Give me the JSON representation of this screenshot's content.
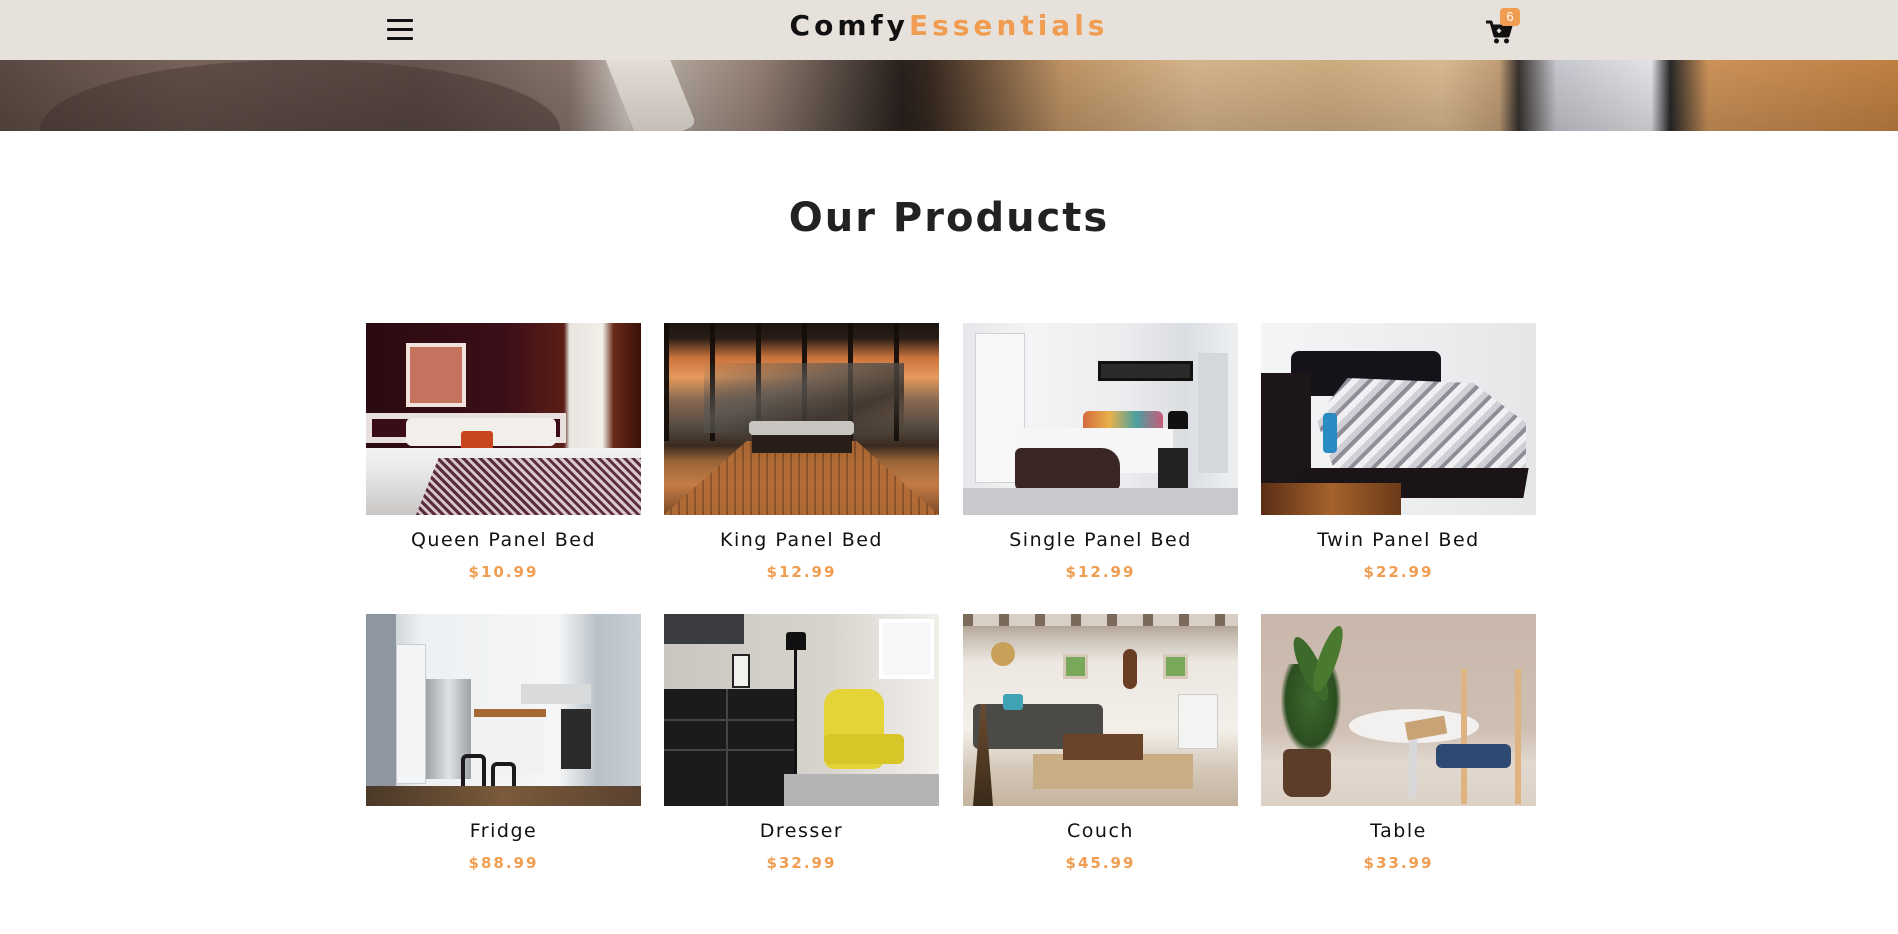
{
  "nav": {
    "brand_part1": "Comfy",
    "brand_part2": "Essentials",
    "menu_icon": "hamburger-menu-icon",
    "cart_icon": "shopping-cart-icon",
    "cart_count": "6"
  },
  "products_section": {
    "title": "Our Products"
  },
  "products": [
    {
      "name": "Queen Panel Bed",
      "price": "$10.99"
    },
    {
      "name": "King Panel Bed",
      "price": "$12.99"
    },
    {
      "name": "Single Panel Bed",
      "price": "$12.99"
    },
    {
      "name": "Twin Panel Bed",
      "price": "$22.99"
    },
    {
      "name": "Fridge",
      "price": "$88.99"
    },
    {
      "name": "Dresser",
      "price": "$32.99"
    },
    {
      "name": "Couch",
      "price": "$45.99"
    },
    {
      "name": "Table",
      "price": "$33.99"
    }
  ],
  "colors": {
    "navbar_bg": "#e7e1dc",
    "accent": "#f09d51",
    "text": "#222222"
  }
}
